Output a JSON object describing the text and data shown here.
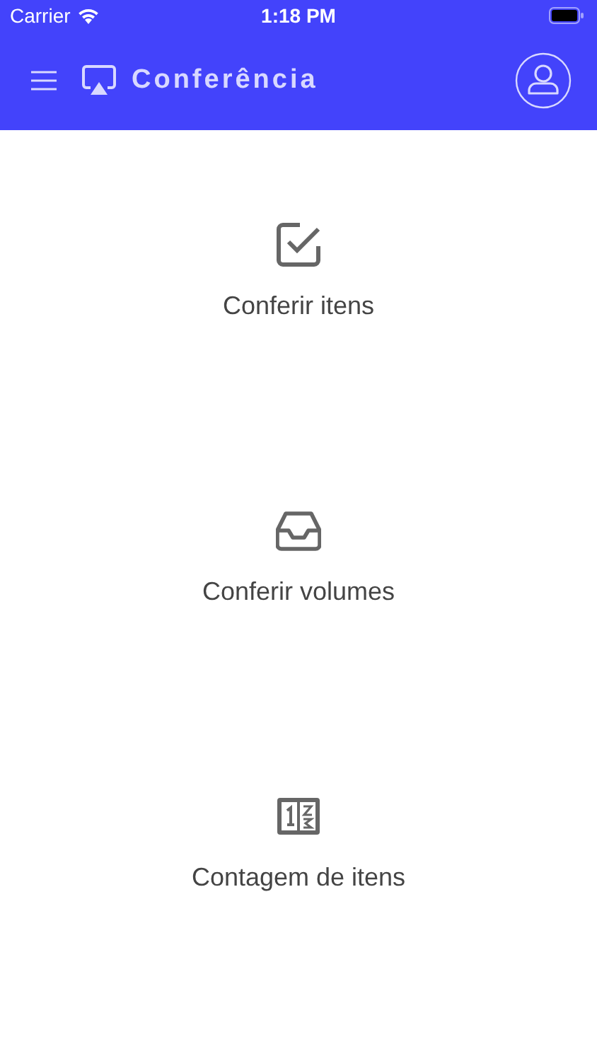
{
  "status_bar": {
    "carrier": "Carrier",
    "time": "1:18 PM"
  },
  "header": {
    "title": "Conferência"
  },
  "menu_items": [
    {
      "label": "Conferir itens"
    },
    {
      "label": "Conferir volumes"
    },
    {
      "label": "Contagem de itens"
    }
  ]
}
